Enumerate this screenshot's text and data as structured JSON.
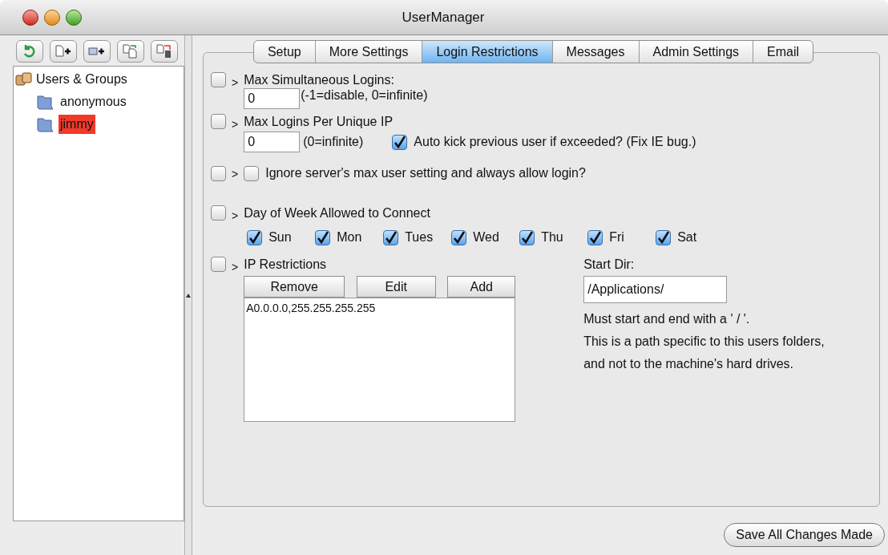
{
  "window": {
    "title": "UserManager"
  },
  "tree": {
    "label": "Users & Groups",
    "children": [
      {
        "label": "anonymous",
        "selected": false
      },
      {
        "label": "jimmy",
        "selected": true
      }
    ]
  },
  "tabs": [
    {
      "label": "Setup",
      "selected": false
    },
    {
      "label": "More Settings",
      "selected": false
    },
    {
      "label": "Login Restrictions",
      "selected": true
    },
    {
      "label": "Messages",
      "selected": false
    },
    {
      "label": "Admin Settings",
      "selected": false
    },
    {
      "label": "Email",
      "selected": false
    }
  ],
  "max_simultaneous": {
    "enabled": false,
    "arrow": ">",
    "label": "Max Simultaneous Logins:",
    "value": "0",
    "hint": "(-1=disable, 0=infinite)"
  },
  "max_per_ip": {
    "enabled": false,
    "arrow": ">",
    "label": "Max Logins Per Unique IP",
    "value": "0",
    "hint": "(0=infinite)",
    "auto_kick": {
      "label": "Auto kick previous user if exceeded? (Fix IE bug.)",
      "checked": true
    }
  },
  "ignore_max": {
    "enabled": false,
    "arrow": ">",
    "label": "Ignore server's max user setting and always allow login?",
    "checked": false
  },
  "days": {
    "enabled": false,
    "arrow": ">",
    "label": "Day of Week Allowed to Connect",
    "items": [
      {
        "label": "Sun",
        "checked": true
      },
      {
        "label": "Mon",
        "checked": true
      },
      {
        "label": "Tues",
        "checked": true
      },
      {
        "label": "Wed",
        "checked": true
      },
      {
        "label": "Thu",
        "checked": true
      },
      {
        "label": "Fri",
        "checked": true
      },
      {
        "label": "Sat",
        "checked": true
      }
    ]
  },
  "ip_restrictions": {
    "enabled": false,
    "arrow": ">",
    "label": "IP Restrictions",
    "buttons": [
      "Remove",
      "Edit",
      "Add"
    ],
    "entries": [
      "A0.0.0.0,255.255.255.255"
    ]
  },
  "start_dir": {
    "label": "Start Dir:",
    "value": "/Applications/",
    "notes": [
      "Must start and end with a ' / '.",
      "This is a path specific to this users folders,",
      "and not to the machine's hard drives."
    ]
  },
  "save_button": "Save All Changes Made"
}
